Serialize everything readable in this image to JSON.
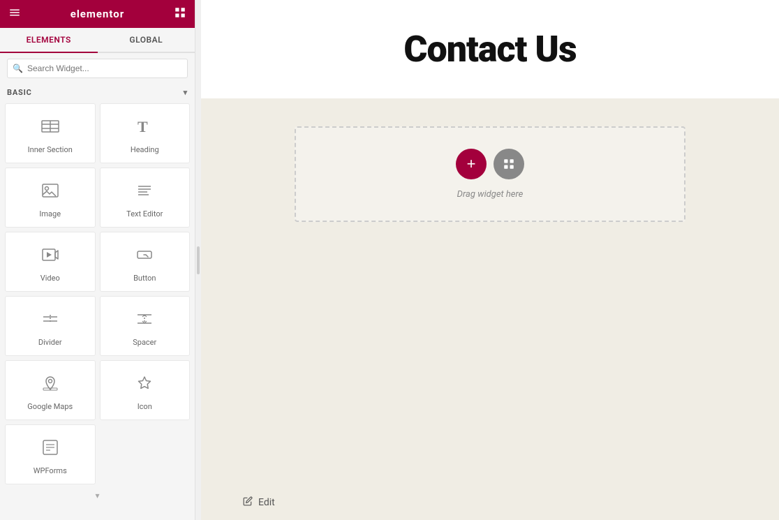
{
  "topbar": {
    "logo": "elementor",
    "menu_icon": "menu-icon",
    "grid_icon": "grid-icon"
  },
  "tabs": [
    {
      "id": "elements",
      "label": "ELEMENTS",
      "active": true
    },
    {
      "id": "global",
      "label": "GLOBAL",
      "active": false
    }
  ],
  "search": {
    "placeholder": "Search Widget..."
  },
  "sections": [
    {
      "id": "basic",
      "label": "BASIC",
      "collapsed": false,
      "widgets": [
        {
          "id": "inner-section",
          "label": "Inner Section",
          "icon": "inner-section-icon"
        },
        {
          "id": "heading",
          "label": "Heading",
          "icon": "heading-icon"
        },
        {
          "id": "image",
          "label": "Image",
          "icon": "image-icon"
        },
        {
          "id": "text-editor",
          "label": "Text Editor",
          "icon": "text-editor-icon"
        },
        {
          "id": "video",
          "label": "Video",
          "icon": "video-icon"
        },
        {
          "id": "button",
          "label": "Button",
          "icon": "button-icon"
        },
        {
          "id": "divider",
          "label": "Divider",
          "icon": "divider-icon"
        },
        {
          "id": "spacer",
          "label": "Spacer",
          "icon": "spacer-icon"
        },
        {
          "id": "google-maps",
          "label": "Google Maps",
          "icon": "google-maps-icon"
        },
        {
          "id": "icon",
          "label": "Icon",
          "icon": "icon-icon"
        },
        {
          "id": "wpforms",
          "label": "WPForms",
          "icon": "wpforms-icon"
        }
      ]
    }
  ],
  "canvas": {
    "page_title": "Contact Us",
    "drop_zone": {
      "drag_hint": "Drag widget here"
    },
    "edit_label": "Edit"
  },
  "colors": {
    "brand": "#a3003c",
    "background": "#f0ede4"
  }
}
